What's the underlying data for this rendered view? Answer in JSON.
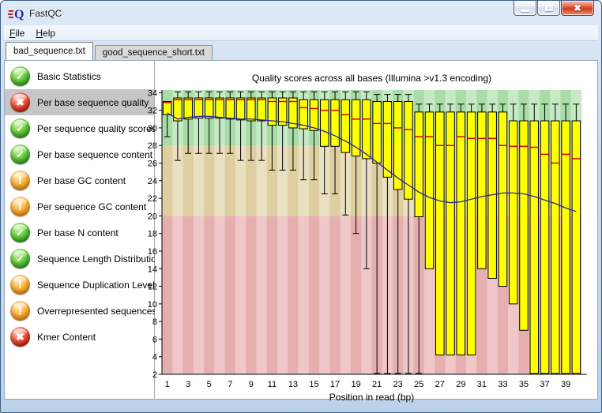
{
  "window": {
    "title": "FastQC"
  },
  "icons": {
    "minimize": "minimize-bar",
    "maximize": "restore-square",
    "close": "✖",
    "pass": "✓",
    "warn": "!",
    "fail": "✖",
    "logo": "fastqc-speeding-q"
  },
  "menu": {
    "items": [
      {
        "label": "File"
      },
      {
        "label": "Help"
      }
    ]
  },
  "tabs": [
    {
      "label": "bad_sequence.txt",
      "active": true
    },
    {
      "label": "good_sequence_short.txt",
      "active": false
    }
  ],
  "sidebar": {
    "items": [
      {
        "label": "Basic Statistics",
        "status": "pass",
        "selected": false
      },
      {
        "label": "Per base sequence quality",
        "status": "fail",
        "selected": true
      },
      {
        "label": "Per sequence quality scores",
        "status": "pass",
        "selected": false
      },
      {
        "label": "Per base sequence content",
        "status": "pass",
        "selected": false
      },
      {
        "label": "Per base GC content",
        "status": "warn",
        "selected": false
      },
      {
        "label": "Per sequence GC content",
        "status": "warn",
        "selected": false
      },
      {
        "label": "Per base N content",
        "status": "pass",
        "selected": false
      },
      {
        "label": "Sequence Length Distribution",
        "status": "pass",
        "selected": false
      },
      {
        "label": "Sequence Duplication Levels",
        "status": "warn",
        "selected": false
      },
      {
        "label": "Overrepresented sequences",
        "status": "warn",
        "selected": false
      },
      {
        "label": "Kmer Content",
        "status": "fail",
        "selected": false
      }
    ]
  },
  "chart_data": {
    "type": "boxplot",
    "title": "Quality scores across all bases (Illumina >v1.3 encoding)",
    "xlabel": "Position in read (bp)",
    "ylim": [
      2,
      34.3
    ],
    "yticks": [
      2,
      4,
      6,
      8,
      10,
      12,
      14,
      16,
      18,
      20,
      22,
      24,
      26,
      28,
      30,
      32,
      34
    ],
    "x": [
      1,
      2,
      3,
      4,
      5,
      6,
      7,
      8,
      9,
      10,
      11,
      12,
      13,
      14,
      15,
      16,
      17,
      18,
      19,
      20,
      21,
      22,
      23,
      24,
      25,
      26,
      27,
      28,
      29,
      30,
      31,
      32,
      33,
      34,
      35,
      36,
      37,
      38,
      39,
      40
    ],
    "x_tick_labels": [
      1,
      3,
      5,
      7,
      9,
      11,
      13,
      15,
      17,
      19,
      21,
      23,
      25,
      27,
      29,
      31,
      33,
      35,
      37,
      39
    ],
    "zones": [
      {
        "name": "good",
        "from": 28,
        "to": 34.3,
        "colors": [
          "#a9dca9",
          "#c6eac6"
        ]
      },
      {
        "name": "medium",
        "from": 20,
        "to": 28,
        "colors": [
          "#ddcfa0",
          "#eadfc1"
        ]
      },
      {
        "name": "poor",
        "from": 2,
        "to": 20,
        "colors": [
          "#e6afaf",
          "#f0c7c7"
        ]
      }
    ],
    "series": {
      "lower_whisker": [
        29.0,
        26.3,
        27.1,
        27.1,
        27.1,
        27.1,
        27.1,
        26.3,
        26.3,
        26.3,
        25.2,
        25.2,
        25.2,
        24.1,
        24.1,
        22.5,
        22.5,
        20.1,
        18.0,
        14.0,
        2.1,
        2.1,
        2.1,
        2.1,
        2.1,
        14.0,
        4.2,
        4.2,
        4.2,
        4.2,
        14.0,
        12.9,
        12.0,
        10.0,
        7.0,
        2.1,
        2.1,
        2.1,
        2.1,
        2.1
      ],
      "q1": [
        31.5,
        30.8,
        31.0,
        31.1,
        31.1,
        31.1,
        31.0,
        30.9,
        30.8,
        30.8,
        30.3,
        30.3,
        30.0,
        29.9,
        29.7,
        27.9,
        27.9,
        27.2,
        26.8,
        26.5,
        26.0,
        24.4,
        23.0,
        21.9,
        19.9,
        14.0,
        4.2,
        4.2,
        4.2,
        4.2,
        14.0,
        12.9,
        12.0,
        10.0,
        7.0,
        2.1,
        2.1,
        2.1,
        2.1,
        2.1
      ],
      "median": [
        32.9,
        33.2,
        33.2,
        33.2,
        33.2,
        33.2,
        33.2,
        33.2,
        33.2,
        33.2,
        33.0,
        33.0,
        33.0,
        32.3,
        32.2,
        32.0,
        32.0,
        31.5,
        31.0,
        31.0,
        30.5,
        30.5,
        30.0,
        29.8,
        29.0,
        29.0,
        28.0,
        28.0,
        29.0,
        28.8,
        28.8,
        28.8,
        28.0,
        27.9,
        27.9,
        27.8,
        27.0,
        26.0,
        27.0,
        26.5
      ],
      "q3": [
        33.0,
        33.4,
        33.4,
        33.4,
        33.4,
        33.4,
        33.4,
        33.4,
        33.4,
        33.4,
        33.4,
        33.4,
        33.4,
        33.2,
        33.2,
        33.2,
        33.2,
        33.2,
        33.2,
        33.2,
        33.0,
        33.0,
        33.0,
        33.0,
        31.8,
        31.8,
        31.8,
        31.8,
        31.8,
        31.8,
        31.8,
        31.8,
        31.8,
        30.8,
        30.8,
        30.8,
        30.8,
        30.8,
        30.8,
        30.8
      ],
      "upper_whisker": [
        33.0,
        34.1,
        34.1,
        34.1,
        34.1,
        34.1,
        34.1,
        34.1,
        34.1,
        34.1,
        34.1,
        34.1,
        34.1,
        34.1,
        34.1,
        34.1,
        34.1,
        34.1,
        34.1,
        34.1,
        33.8,
        33.8,
        33.8,
        33.8,
        32.7,
        32.7,
        32.7,
        32.7,
        32.7,
        32.7,
        32.7,
        32.7,
        32.7,
        32.7,
        32.7,
        32.7,
        32.7,
        32.7,
        32.7,
        32.7
      ],
      "mean": [
        31.7,
        31.0,
        31.2,
        31.3,
        31.3,
        31.2,
        31.1,
        31.0,
        31.0,
        30.9,
        30.8,
        30.7,
        30.5,
        30.3,
        30.0,
        29.6,
        29.1,
        28.5,
        27.8,
        27.0,
        26.1,
        25.2,
        24.3,
        23.5,
        22.7,
        22.1,
        21.7,
        21.5,
        21.6,
        21.9,
        22.2,
        22.4,
        22.6,
        22.6,
        22.5,
        22.2,
        21.8,
        21.4,
        20.9,
        20.5
      ]
    },
    "colors": {
      "box": "#ffff00",
      "median": "#d40000",
      "whisker": "#000000",
      "mean_line": "#26269e"
    },
    "legend_position": "none",
    "grid": false
  }
}
